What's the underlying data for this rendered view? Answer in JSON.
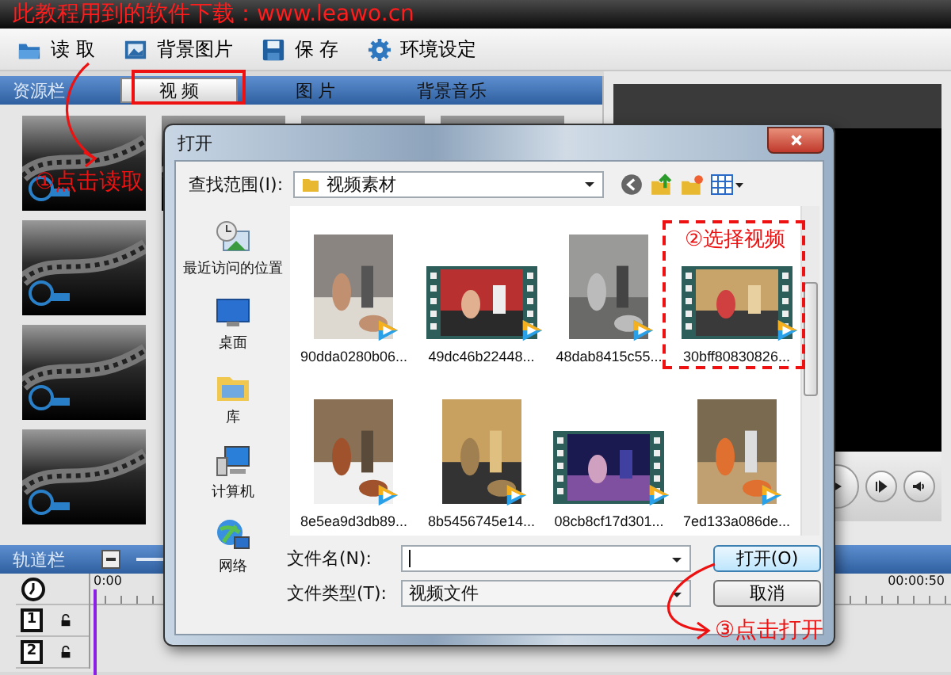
{
  "banner": {
    "text": "此教程用到的软件下载：www.leawo.cn"
  },
  "toolbar": [
    {
      "label": "读 取"
    },
    {
      "label": "背景图片"
    },
    {
      "label": "保 存"
    },
    {
      "label": "环境设定"
    }
  ],
  "resource_panel": {
    "title": "资源栏",
    "tabs": [
      {
        "label": "视 频",
        "selected": true
      },
      {
        "label": "图 片",
        "selected": false
      },
      {
        "label": "背景音乐",
        "selected": false
      }
    ]
  },
  "timeline": {
    "title": "轨道栏",
    "ruler": [
      "0:00",
      "00:00:50"
    ],
    "tracks": [
      "1",
      "2"
    ]
  },
  "dialog": {
    "title": "打开",
    "look_in_label": "查找范围(I):",
    "look_in_value": "视频素材",
    "places": [
      "最近访问的位置",
      "桌面",
      "库",
      "计算机",
      "网络"
    ],
    "files": [
      {
        "name": "90dda0280b06...",
        "kind": "portrait"
      },
      {
        "name": "49dc46b22448...",
        "kind": "filmstrip"
      },
      {
        "name": "48dab8415c55...",
        "kind": "portrait"
      },
      {
        "name": "30bff80830826...",
        "kind": "filmstrip"
      },
      {
        "name": "8e5ea9d3db89...",
        "kind": "portrait"
      },
      {
        "name": "8b5456745e14...",
        "kind": "portrait"
      },
      {
        "name": "08cb8cf17d301...",
        "kind": "filmstrip"
      },
      {
        "name": "7ed133a086de...",
        "kind": "portrait"
      }
    ],
    "file_name_label": "文件名(N):",
    "file_type_label": "文件类型(T):",
    "file_type_value": "视频文件",
    "buttons": [
      "打开(O)",
      "取消"
    ]
  },
  "annotations": [
    {
      "text": "①点击读取"
    },
    {
      "text": "②选择视频"
    },
    {
      "text": "③点击打开"
    }
  ]
}
